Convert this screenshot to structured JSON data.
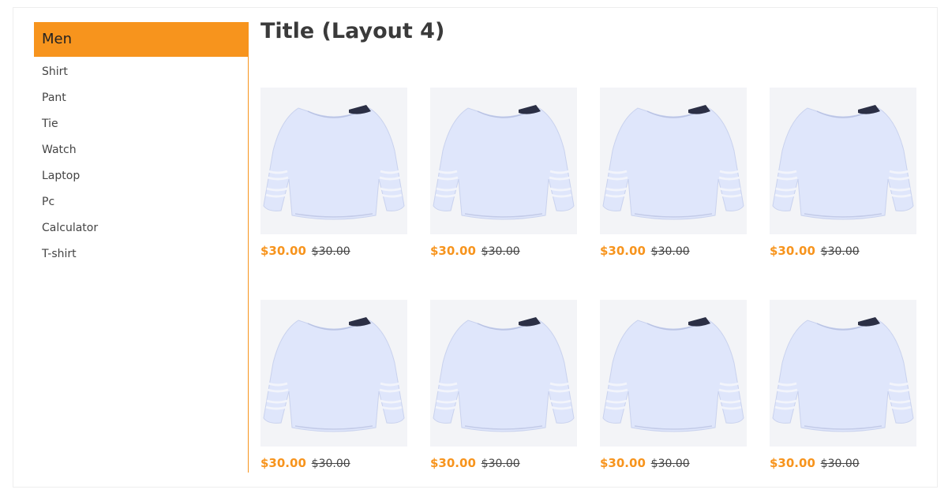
{
  "sidebar": {
    "header": "Men",
    "items": [
      {
        "label": "Shirt"
      },
      {
        "label": "Pant"
      },
      {
        "label": "Tie"
      },
      {
        "label": "Watch"
      },
      {
        "label": "Laptop"
      },
      {
        "label": "Pc"
      },
      {
        "label": "Calculator"
      },
      {
        "label": "T-shirt"
      }
    ]
  },
  "main": {
    "title": "Title (Layout 4)",
    "products": [
      {
        "price": "$30.00",
        "old_price": "$30.00",
        "image": "blouse-icon"
      },
      {
        "price": "$30.00",
        "old_price": "$30.00",
        "image": "blouse-icon"
      },
      {
        "price": "$30.00",
        "old_price": "$30.00",
        "image": "blouse-icon"
      },
      {
        "price": "$30.00",
        "old_price": "$30.00",
        "image": "blouse-icon"
      },
      {
        "price": "$30.00",
        "old_price": "$30.00",
        "image": "blouse-icon"
      },
      {
        "price": "$30.00",
        "old_price": "$30.00",
        "image": "blouse-icon"
      },
      {
        "price": "$30.00",
        "old_price": "$30.00",
        "image": "blouse-icon"
      },
      {
        "price": "$30.00",
        "old_price": "$30.00",
        "image": "blouse-icon"
      }
    ]
  },
  "colors": {
    "accent": "#f7941d",
    "image_bg": "#f3f4f7",
    "garment": "#dfe6fb"
  }
}
